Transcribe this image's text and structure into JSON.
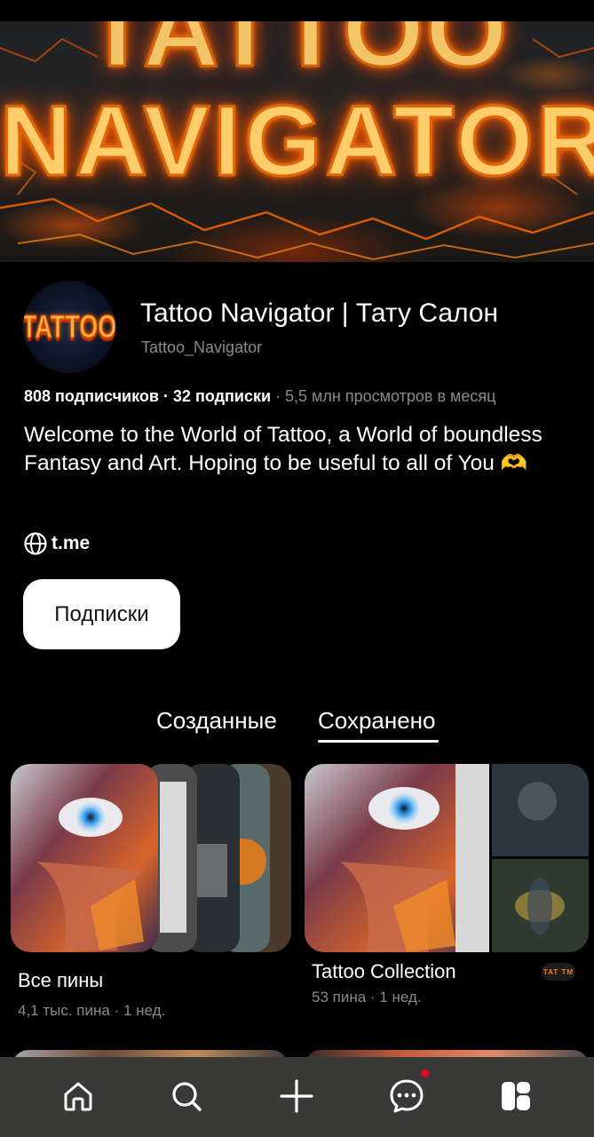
{
  "banner": {
    "line_top": "TATTOO",
    "line_main": "NAVIGATOR"
  },
  "profile": {
    "avatar_text": "TATTOO",
    "title": "Tattoo Navigator | Тату Салон",
    "username": "Tattoo_Navigator",
    "followers": "808 подписчиков",
    "following": "32 подписки",
    "separator": " · ",
    "views": "5,5 млн просмотров в месяц",
    "bio": "Welcome to the World of Tattoo, a World of boundless Fantasy and Art. Hoping to be useful to all of You 🫶",
    "link": "t.me",
    "follow_button": "Подписки"
  },
  "tabs": [
    {
      "label": "Созданные",
      "active": false
    },
    {
      "label": "Сохранено",
      "active": true
    }
  ],
  "boards": [
    {
      "name": "Все пины",
      "meta": "4,1 тыс. пина · 1 нед."
    },
    {
      "name": "Tattoo Collection",
      "meta": "53 пина · 1 нед.",
      "collaborator_badge": "TAT TM"
    }
  ],
  "bottom_nav": [
    {
      "icon": "home-icon",
      "active": false
    },
    {
      "icon": "search-icon",
      "active": false
    },
    {
      "icon": "plus-icon",
      "active": false
    },
    {
      "icon": "messages-icon",
      "active": false,
      "notification": true
    },
    {
      "icon": "saved-icon",
      "active": true
    }
  ],
  "colors": {
    "background": "#000000",
    "text": "#ffffff",
    "muted": "#8a8a8a",
    "nav_background": "#393937",
    "notification": "#e60023",
    "button_bg": "#ffffff"
  }
}
